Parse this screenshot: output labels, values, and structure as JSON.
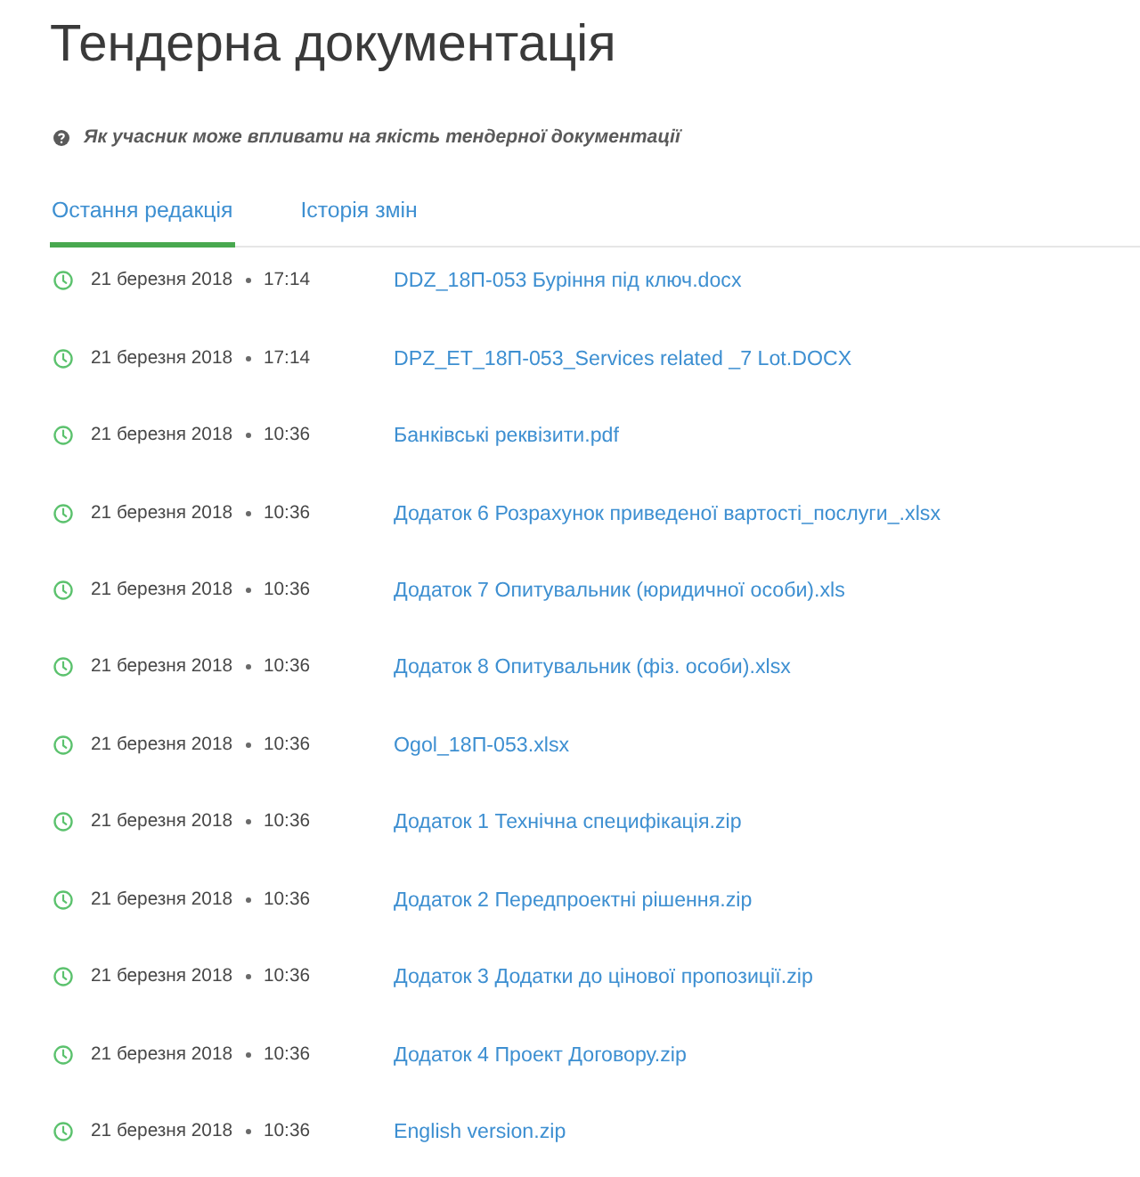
{
  "page": {
    "title": "Тендерна документація"
  },
  "help_link": {
    "text": "Як учасник може впливати на якість тендерної документації"
  },
  "tabs": [
    {
      "label": "Остання редакція",
      "selected": true
    },
    {
      "label": "Історія змін",
      "selected": false
    }
  ],
  "documents": [
    {
      "date": "21 березня 2018",
      "time": "17:14",
      "file": "DDZ_18П-053 Буріння під ключ.docx"
    },
    {
      "date": "21 березня 2018",
      "time": "17:14",
      "file": "DPZ_ET_18П-053_Services related _7 Lot.DOCX"
    },
    {
      "date": "21 березня 2018",
      "time": "10:36",
      "file": "Банківські реквізити.pdf"
    },
    {
      "date": "21 березня 2018",
      "time": "10:36",
      "file": "Додаток 6 Розрахунок приведеної вартості_послуги_.xlsx"
    },
    {
      "date": "21 березня 2018",
      "time": "10:36",
      "file": "Додаток 7 Опитувальник (юридичної особи).xls"
    },
    {
      "date": "21 березня 2018",
      "time": "10:36",
      "file": "Додаток 8 Опитувальник (фіз. особи).xlsx"
    },
    {
      "date": "21 березня 2018",
      "time": "10:36",
      "file": "Ogol_18П-053.xlsx"
    },
    {
      "date": "21 березня 2018",
      "time": "10:36",
      "file": "Додаток 1 Технічна специфікація.zip"
    },
    {
      "date": "21 березня 2018",
      "time": "10:36",
      "file": "Додаток 2 Передпроектні рішення.zip"
    },
    {
      "date": "21 березня 2018",
      "time": "10:36",
      "file": "Додаток 3 Додатки до цінової пропозиції.zip"
    },
    {
      "date": "21 березня 2018",
      "time": "10:36",
      "file": "Додаток 4 Проект Договору.zip"
    },
    {
      "date": "21 березня 2018",
      "time": "10:36",
      "file": "English version.zip"
    }
  ]
}
